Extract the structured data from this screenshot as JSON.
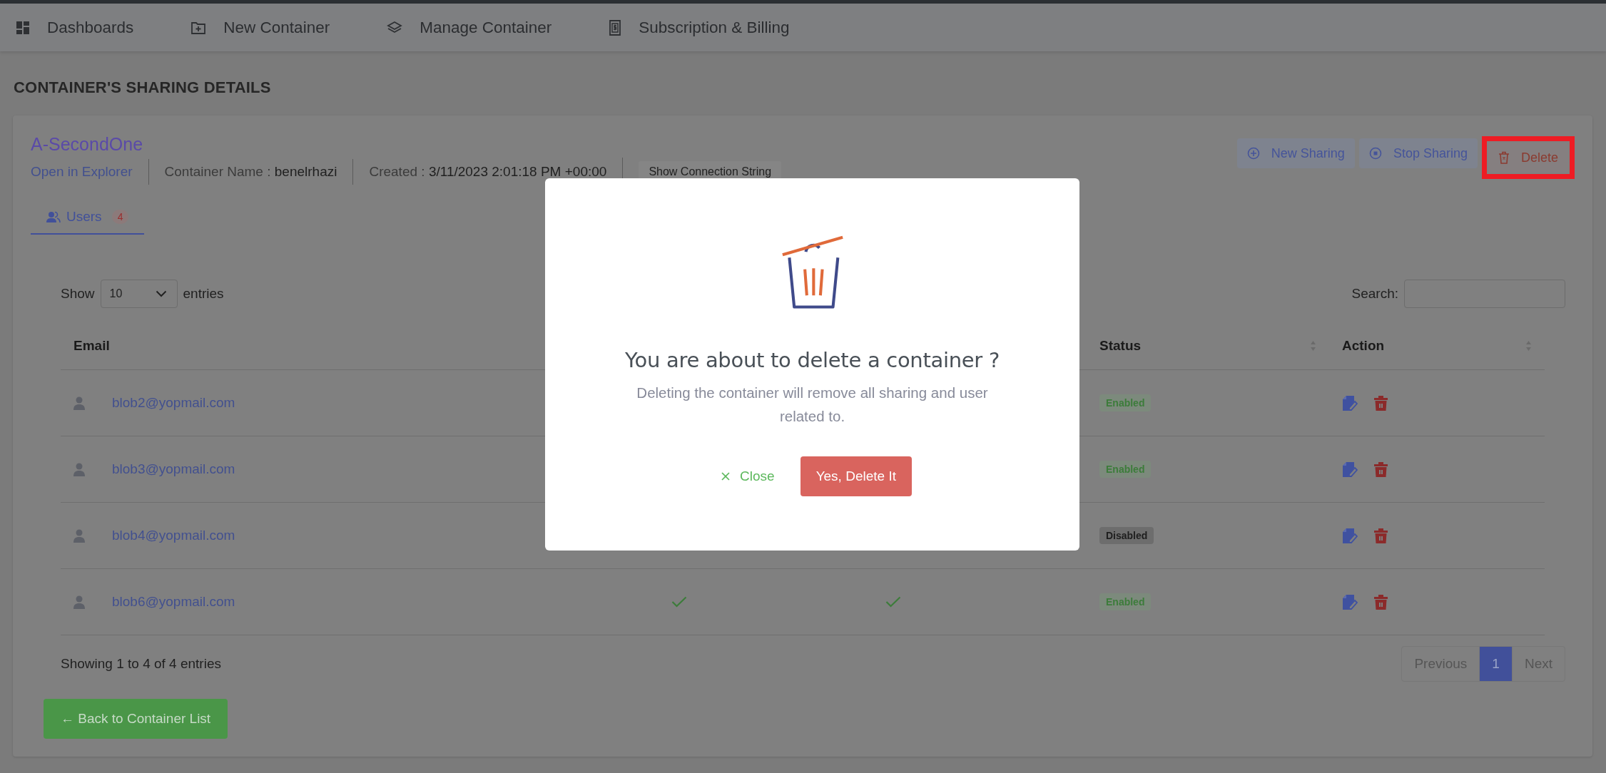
{
  "nav": [
    {
      "label": "Dashboards"
    },
    {
      "label": "New Container"
    },
    {
      "label": "Manage Container"
    },
    {
      "label": "Subscription & Billing"
    }
  ],
  "page_title": "CONTAINER'S SHARING DETAILS",
  "container": {
    "name": "A-SecondOne",
    "open_link": "Open in Explorer",
    "container_name_label": "Container Name :",
    "container_name": "benelrhazi",
    "created_label": "Created :",
    "created": "3/11/2023 2:01:18 PM +00:00",
    "connection_button": "Show Connection String"
  },
  "actions": [
    {
      "label": "New Sharing",
      "highlighted": false
    },
    {
      "label": "Stop Sharing",
      "highlighted": false
    },
    {
      "label": "Delete",
      "highlighted": true
    }
  ],
  "tabs": [
    {
      "label": "Users",
      "count": "4",
      "selected": true
    }
  ],
  "length": {
    "show": "Show",
    "value": "10",
    "entries": "entries"
  },
  "search": {
    "label": "Search:"
  },
  "table": {
    "columns": [
      {
        "label": "Email"
      },
      {
        "label": "Status",
        "sortable": true
      },
      {
        "label": "Action",
        "sortable": true
      }
    ],
    "rows": [
      {
        "email": "blob2@yopmail.com",
        "status": "Enabled",
        "enabled": true
      },
      {
        "email": "blob3@yopmail.com",
        "status": "Enabled",
        "enabled": true
      },
      {
        "email": "blob4@yopmail.com",
        "status": "Disabled",
        "enabled": false
      },
      {
        "email": "blob6@yopmail.com",
        "column_2_checked": true,
        "column_3_checked": true,
        "status": "Enabled",
        "enabled": true
      }
    ]
  },
  "info": "Showing 1 to 4 of 4 entries",
  "pagination": [
    {
      "label": "Previous",
      "selected": false
    },
    {
      "label": "1",
      "selected": true
    },
    {
      "label": "Next",
      "selected": false
    }
  ],
  "back_button": "← Back to Container List",
  "modal": {
    "title": "You are about to delete a container ?",
    "message": "Deleting the container will remove all sharing and user related to.",
    "close": "Close",
    "confirm": "Yes, Delete It"
  }
}
